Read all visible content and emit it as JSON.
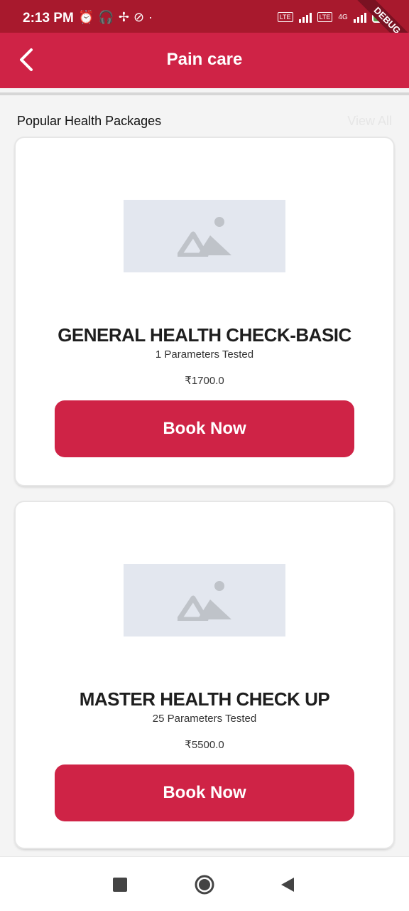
{
  "status_bar": {
    "time": "2:13 PM",
    "battery": "33",
    "network": "4G",
    "lte_label": "LTE",
    "debug_label": "DEBUG",
    "icons": [
      "alarm-icon",
      "headphones-icon",
      "slack-icon",
      "sync-icon",
      "dot-icon"
    ]
  },
  "app_bar": {
    "title": "Pain care",
    "back_icon": "chevron-left-icon"
  },
  "section": {
    "title": "Popular Health Packages",
    "view_all": "View All"
  },
  "packages": [
    {
      "name": "GENERAL HEALTH CHECK-BASIC",
      "params": "1 Parameters Tested",
      "price": "₹1700.0",
      "button": "Book Now"
    },
    {
      "name": "MASTER HEALTH CHECK UP",
      "params": "25 Parameters Tested",
      "price": "₹5500.0",
      "button": "Book Now"
    }
  ],
  "nav_bar": {
    "icons": [
      "recents-icon",
      "home-icon",
      "back-icon"
    ]
  },
  "colors": {
    "primary": "#cf2346",
    "status_bar": "#a8192d",
    "placeholder": "#e3e7ef"
  }
}
